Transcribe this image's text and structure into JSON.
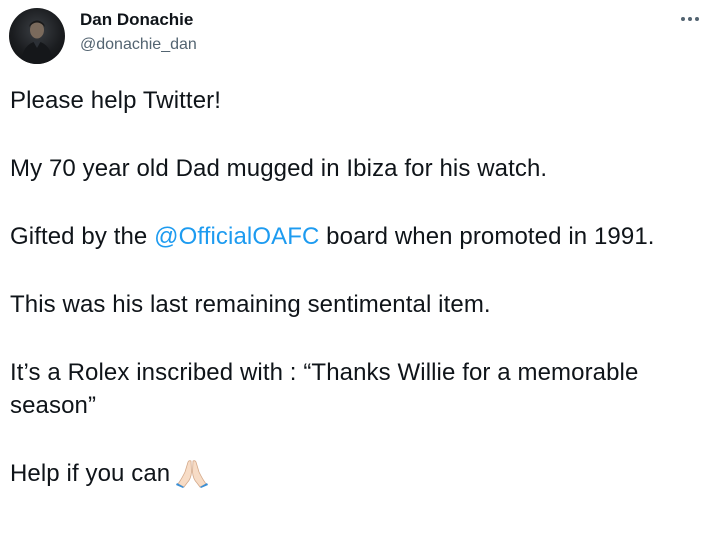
{
  "author": {
    "display_name": "Dan Donachie",
    "handle": "@donachie_dan"
  },
  "icons": {
    "avatar": "profile-photo",
    "more": "more-options-icon",
    "emoji": "folded-hands-emoji"
  },
  "colors": {
    "text": "#0f1419",
    "secondary": "#536471",
    "link": "#1d9bf0"
  },
  "tweet": {
    "p1": "Please help Twitter!",
    "p2": "My 70 year old Dad mugged in Ibiza for his watch.",
    "p3_before": "Gifted by the ",
    "p3_mention": "@OfficialOAFC",
    "p3_after": " board when promoted in 1991.",
    "p4": "This was his last remaining sentimental item.",
    "p5": "It’s a Rolex inscribed with : “Thanks Willie for a memorable season”",
    "p6": "Help if you can"
  }
}
